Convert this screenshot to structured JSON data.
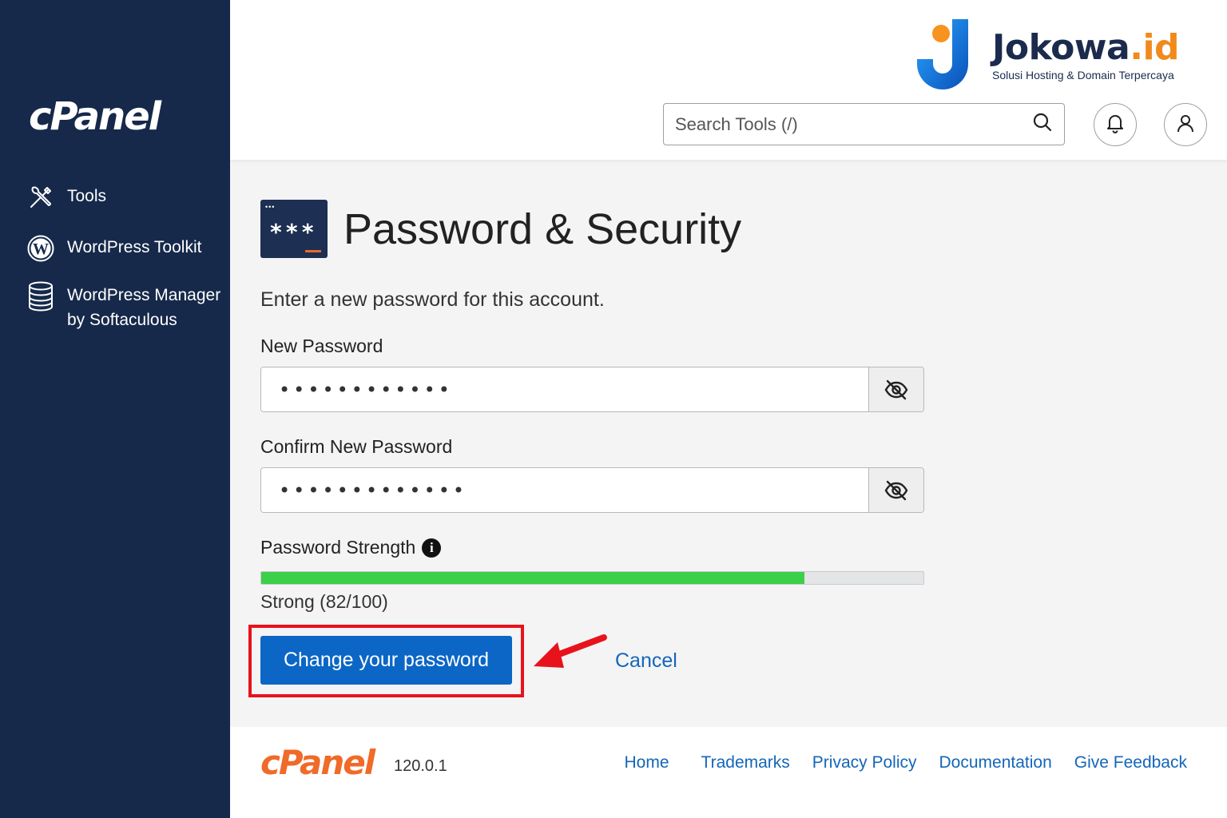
{
  "sidebar": {
    "logo": "cPanel",
    "items": [
      {
        "label": "Tools",
        "icon": "tools-icon"
      },
      {
        "label": "WordPress Toolkit",
        "icon": "wordpress-icon"
      },
      {
        "label": "WordPress Manager by Softaculous",
        "icon": "database-icon"
      }
    ]
  },
  "header": {
    "brand_name": "Jokowa",
    "brand_tld": ".id",
    "brand_tagline": "Solusi Hosting & Domain Terpercaya",
    "search_placeholder": "Search Tools (/)"
  },
  "main": {
    "title": "Password & Security",
    "intro": "Enter a new password for this account.",
    "new_password_label": "New Password",
    "new_password_value": "••••••••••••",
    "confirm_password_label": "Confirm New Password",
    "confirm_password_value": "•••••••••••••",
    "strength_label": "Password Strength",
    "strength_score": 82,
    "strength_max": 100,
    "strength_text": "Strong (82/100)",
    "submit_label": "Change your password",
    "cancel_label": "Cancel"
  },
  "footer": {
    "logo": "cPanel",
    "version": "120.0.1",
    "links": [
      "Home",
      "Trademarks",
      "Privacy Policy",
      "Documentation",
      "Give Feedback"
    ]
  },
  "colors": {
    "sidebar_bg": "#16294a",
    "primary": "#0b66c6",
    "link": "#1466b8",
    "strength_fill": "#3ccf4a",
    "highlight": "#e8121b",
    "brand_orange": "#f08a1c"
  }
}
